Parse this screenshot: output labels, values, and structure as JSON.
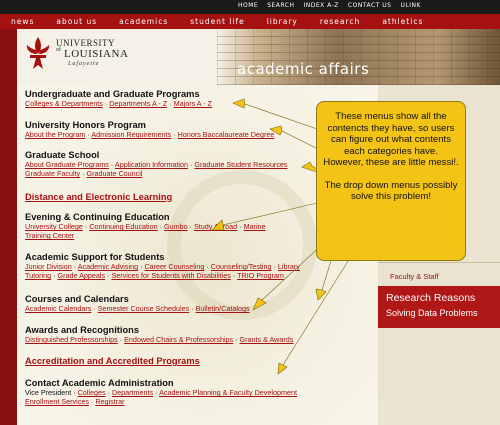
{
  "utility_nav": [
    "HOME",
    "SEARCH",
    "INDEX A-Z",
    "CONTACT US",
    "ULINK"
  ],
  "main_nav": [
    "news",
    "about us",
    "academics",
    "student life",
    "library",
    "research",
    "athletics"
  ],
  "logo": {
    "line1": "UNIVERSITY",
    "of": "of",
    "line2": "LOUISIANA",
    "line3": "Lafayette"
  },
  "section_title": "academic affairs",
  "groups": [
    {
      "heading": "Undergraduate and Graduate Programs",
      "links": [
        "Colleges & Departments",
        "Departments A - Z",
        "Majors A - Z"
      ]
    },
    {
      "heading": "University Honors Program",
      "links": [
        "About the Program",
        "Admission Requirements",
        "Honors Baccalaureate Degree"
      ]
    },
    {
      "heading": "Graduate School",
      "links": [
        "About Graduate Programs",
        "Application Information",
        "Graduate Student Resources"
      ],
      "links2": [
        "Graduate Faculty",
        "Graduate Council"
      ]
    },
    {
      "heading": "Distance and Electronic Learning"
    },
    {
      "heading": "Evening & Continuing Education",
      "links": [
        "University College",
        "Continuing Education",
        "Gumbo",
        "Study Abroad",
        "Marine"
      ],
      "links2": [
        "Training Center"
      ]
    },
    {
      "heading": "Academic Support for Students",
      "links": [
        "Junior Division",
        "Academic Advising",
        "Career Counseling",
        "Counseling/Testing",
        "Library"
      ],
      "links2": [
        "Tutoring",
        "Grade Appeals",
        "Services for Students with Disabilities",
        "TRIO Program"
      ]
    },
    {
      "heading": "Courses and Calendars",
      "links": [
        "Academic Calendars",
        "Semester Course Schedules",
        "Bulletin/Catalogs"
      ]
    },
    {
      "heading": "Awards and Recognitions",
      "links": [
        "Distinguished Professorships",
        "Endowed Chairs & Professorships",
        "Grants & Awards"
      ]
    },
    {
      "heading": "Accreditation and Accredited Programs"
    },
    {
      "heading": "Contact Academic Administration",
      "lead": "Vice President",
      "links": [
        "Colleges",
        "Departments",
        "Academic Planning & Faculty Development"
      ],
      "links2": [
        "Enrollment Services",
        "Registrar"
      ]
    }
  ],
  "right_menu": {
    "partial1": "ds",
    "faculty": "Faculty & Staff"
  },
  "research": {
    "line1": "Research Reasons",
    "line2": "Solving Data Problems"
  },
  "callout": {
    "p1": "These menus show all the contencts they have, so users can figure out what contents each categories have. However, these are little messi!.",
    "p2": "The drop down menus possibly solve this problem!"
  }
}
